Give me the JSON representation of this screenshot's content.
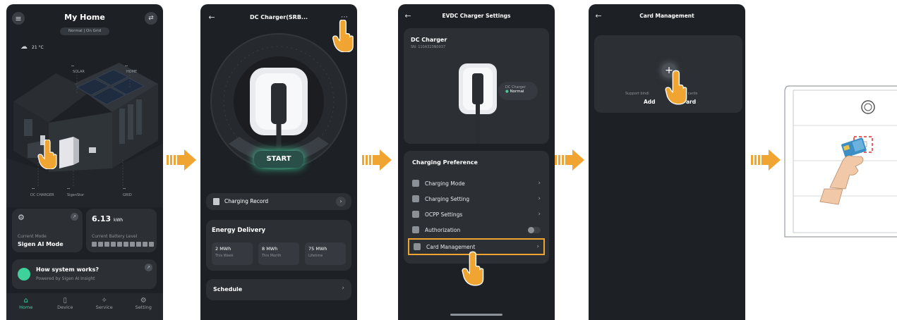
{
  "screen1": {
    "title": "My Home",
    "subtitle": "Normal | On Grid",
    "weather": "21 °C",
    "label_solar": "SOLAR",
    "label_home": "HOME",
    "label_dc_charger": "DC CHARGER",
    "label_sigenstor": "SigenStor",
    "label_grid": "GRID",
    "dashes": "--",
    "mode_caption": "Current Mode",
    "mode_value": "Sigen AI Mode",
    "battery_value": "6.13",
    "battery_unit": "kWh",
    "battery_caption": "Current Battery Level",
    "promo_title": "How system works?",
    "promo_sub": "Powered by Sigen AI Insight",
    "nav": [
      "Home",
      "Device",
      "Service",
      "Setting"
    ]
  },
  "screen2": {
    "title": "DC Charger(SRB...",
    "start": "START",
    "charging_record": "Charging Record",
    "energy_title": "Energy Delivery",
    "energy": [
      {
        "value": "2 MWh",
        "label": "This Week"
      },
      {
        "value": "8 MWh",
        "label": "This Month"
      },
      {
        "value": "75 MWh",
        "label": "Lifetime"
      }
    ],
    "schedule": "Schedule"
  },
  "screen3": {
    "title": "EVDC Charger Settings",
    "device_name": "DC Charger",
    "device_sn": "SN: 110A323N0037",
    "status_name": "DC Charger",
    "status_value": "Normal",
    "pref_title": "Charging Preference",
    "items": [
      "Charging Mode",
      "Charging Setting",
      "OCPP Settings",
      "Authorization",
      "Card Management"
    ]
  },
  "screen4": {
    "title": "Card Management",
    "support_text_a": "Support bindi",
    "support_text_b": "5 cards",
    "add_text_a": "Add",
    "add_text_b": "ard"
  },
  "colors": {
    "accent": "#f0a431",
    "phone_bg": "#1d2024",
    "card_bg": "#2c3035",
    "green": "#3fd19c"
  }
}
